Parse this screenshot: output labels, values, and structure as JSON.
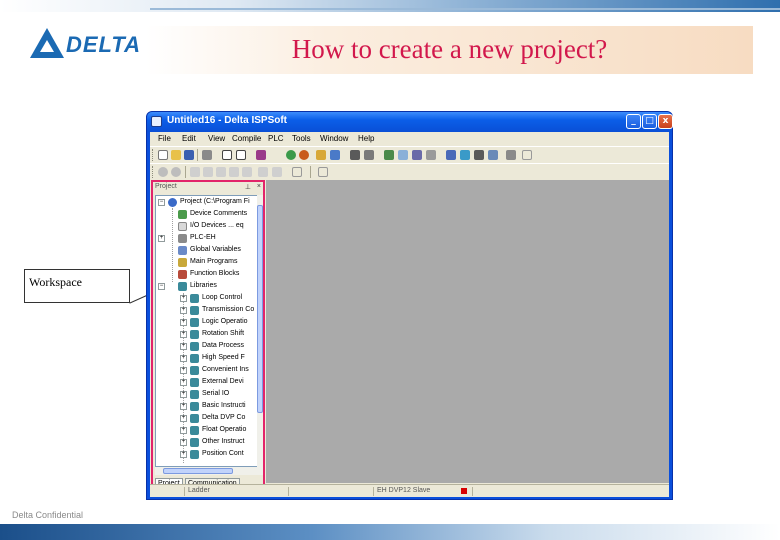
{
  "slide": {
    "title": "How to create a new project?",
    "logo_text": "DELTA",
    "footer": "Delta Confidential",
    "callout": "Workspace"
  },
  "colors": {
    "title": "#d2184c",
    "logo": "#1b6ab3",
    "highlight_border": "#e2246a",
    "titlebar": "#0a4fd6"
  },
  "window": {
    "title": "Untitled16 - Delta ISPSoft",
    "buttons": [
      "_",
      "□",
      "x"
    ]
  },
  "menu": [
    "File",
    "Edit",
    "View",
    "Compile",
    "PLC",
    "Tools",
    "Window",
    "Help"
  ],
  "workspace": {
    "header": "Project",
    "root": "Project (C:\\Program Fi",
    "items": [
      {
        "label": "Device Comments",
        "icon": "device-icon",
        "depth": 1
      },
      {
        "label": "I/O Devices ... eq",
        "icon": "io-icon",
        "depth": 1
      },
      {
        "label": "PLC-EH",
        "icon": "plc-icon",
        "depth": 1
      },
      {
        "label": "Global Variables",
        "icon": "variables-icon",
        "depth": 1
      },
      {
        "label": "Main Programs",
        "icon": "programs-icon",
        "depth": 1
      },
      {
        "label": "Function Blocks",
        "icon": "function-blocks-icon",
        "depth": 1
      },
      {
        "label": "Libraries",
        "icon": "library-icon",
        "depth": 1
      },
      {
        "label": "Loop Control",
        "icon": "library-icon",
        "depth": 2
      },
      {
        "label": "Transmission Co",
        "icon": "library-icon",
        "depth": 2
      },
      {
        "label": "Logic Operatio",
        "icon": "library-icon",
        "depth": 2
      },
      {
        "label": "Rotation Shift",
        "icon": "library-icon",
        "depth": 2
      },
      {
        "label": "Data Process",
        "icon": "library-icon",
        "depth": 2
      },
      {
        "label": "High Speed F",
        "icon": "library-icon",
        "depth": 2
      },
      {
        "label": "Convenient Ins",
        "icon": "library-icon",
        "depth": 2
      },
      {
        "label": "External Devi",
        "icon": "library-icon",
        "depth": 2
      },
      {
        "label": "Serial IO",
        "icon": "library-icon",
        "depth": 2
      },
      {
        "label": "Basic Instructi",
        "icon": "library-icon",
        "depth": 2
      },
      {
        "label": "Delta DVP Co",
        "icon": "library-icon",
        "depth": 2
      },
      {
        "label": "Float Operatio",
        "icon": "library-icon",
        "depth": 2
      },
      {
        "label": "Other Instruct",
        "icon": "library-icon",
        "depth": 2
      },
      {
        "label": "Position Cont",
        "icon": "library-icon",
        "depth": 2
      }
    ],
    "tabs": [
      "Project",
      "Communication"
    ]
  },
  "status": {
    "mode": "Ladder",
    "plc": "EH DVP12 Slave"
  }
}
